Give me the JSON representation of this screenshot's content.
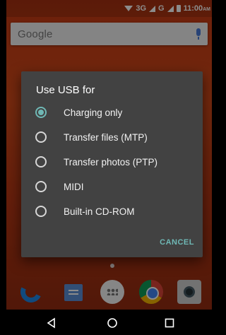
{
  "status_bar": {
    "network_label": "3G",
    "network_label_2": "G",
    "time": "11:00",
    "time_suffix": "AM"
  },
  "search": {
    "logo_text": "Google"
  },
  "dialog": {
    "title": "Use USB for",
    "options": [
      {
        "label": "Charging only",
        "selected": true
      },
      {
        "label": "Transfer files (MTP)",
        "selected": false
      },
      {
        "label": "Transfer photos (PTP)",
        "selected": false
      },
      {
        "label": "MIDI",
        "selected": false
      },
      {
        "label": "Built-in CD-ROM",
        "selected": false
      }
    ],
    "cancel_label": "CANCEL"
  },
  "dock": {
    "icons": [
      "phone-icon",
      "messages-icon",
      "apps-icon",
      "chrome-icon",
      "camera-icon"
    ]
  },
  "nav": {
    "icons": [
      "back-icon",
      "home-icon",
      "recent-apps-icon"
    ]
  },
  "colors": {
    "accent": "#6fb8b5",
    "dialog_bg": "#424242",
    "wallpaper": "#c53a14"
  }
}
